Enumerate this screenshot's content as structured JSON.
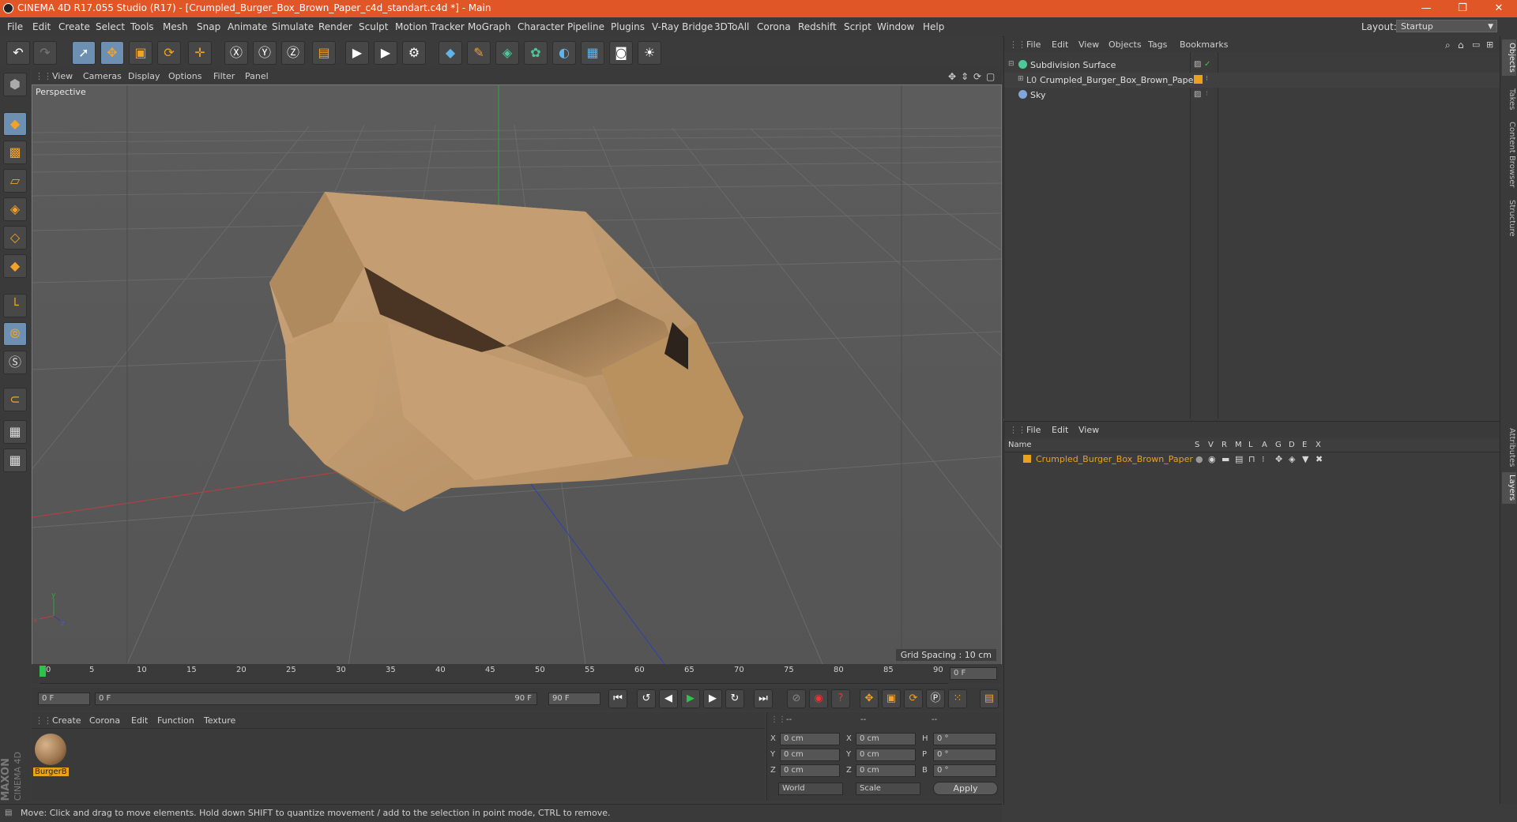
{
  "window": {
    "title": "CINEMA 4D R17.055 Studio (R17) - [Crumpled_Burger_Box_Brown_Paper_c4d_standart.c4d *] - Main",
    "minimize": "—",
    "restore": "❐",
    "close": "✕"
  },
  "menubar": [
    "File",
    "Edit",
    "Create",
    "Select",
    "Tools",
    "Mesh",
    "Snap",
    "Animate",
    "Simulate",
    "Render",
    "Sculpt",
    "Motion Tracker",
    "MoGraph",
    "Character",
    "Pipeline",
    "Plugins",
    "V-Ray Bridge",
    "3DToAll",
    "Corona",
    "Redshift",
    "Script",
    "Window",
    "Help"
  ],
  "layout": {
    "label": "Layout:",
    "value": "Startup"
  },
  "viewport": {
    "menu": [
      "View",
      "Cameras",
      "Display",
      "Options",
      "Filter",
      "Panel"
    ],
    "label": "Perspective",
    "grid_spacing": "Grid Spacing : 10 cm"
  },
  "timeline": {
    "ticks": [
      "0",
      "5",
      "10",
      "15",
      "20",
      "25",
      "30",
      "35",
      "40",
      "45",
      "50",
      "55",
      "60",
      "65",
      "70",
      "75",
      "80",
      "85",
      "90"
    ],
    "current_frame": "0 F"
  },
  "transport": {
    "start_field": "0 F",
    "range_start": "0 F",
    "range_end": "90 F",
    "end_field": "90 F"
  },
  "materials": {
    "menu": [
      "Create",
      "Corona",
      "Edit",
      "Function",
      "Texture"
    ],
    "items": [
      {
        "name": "BurgerB"
      }
    ]
  },
  "coords": {
    "headers": [
      "--",
      "--",
      "--"
    ],
    "rows": [
      {
        "a": "X",
        "av": "0 cm",
        "b": "X",
        "bv": "0 cm",
        "c": "H",
        "cv": "0 °"
      },
      {
        "a": "Y",
        "av": "0 cm",
        "b": "Y",
        "bv": "0 cm",
        "c": "P",
        "cv": "0 °"
      },
      {
        "a": "Z",
        "av": "0 cm",
        "b": "Z",
        "bv": "0 cm",
        "c": "B",
        "cv": "0 °"
      }
    ],
    "mode1": "World",
    "mode2": "Scale",
    "apply": "Apply"
  },
  "status": "Move: Click and drag to move elements. Hold down SHIFT to quantize movement / add to the selection in point mode, CTRL to remove.",
  "brand": {
    "line1": "MAXON",
    "line2": "CINEMA 4D"
  },
  "object_manager": {
    "menu": [
      "File",
      "Edit",
      "View",
      "Objects",
      "Tags",
      "Bookmarks"
    ],
    "objects": [
      {
        "name": "Subdivision Surface",
        "color": "#4cc99a"
      },
      {
        "name": "Crumpled_Burger_Box_Brown_Paper",
        "color": "#b0b0b0"
      },
      {
        "name": "Sky",
        "color": "#7fa7d9"
      }
    ]
  },
  "layer_manager": {
    "menu": [
      "File",
      "Edit",
      "View"
    ],
    "columns": [
      "Name",
      "S",
      "V",
      "R",
      "M",
      "L",
      "A",
      "G",
      "D",
      "E",
      "X"
    ],
    "layers": [
      {
        "name": "Crumpled_Burger_Box_Brown_Paper",
        "color": "#e8a31a"
      }
    ]
  },
  "side_tabs": [
    "Objects",
    "Takes",
    "Content Browser",
    "Structure"
  ],
  "side_tabs_lower": [
    "Attributes",
    "Layers"
  ]
}
